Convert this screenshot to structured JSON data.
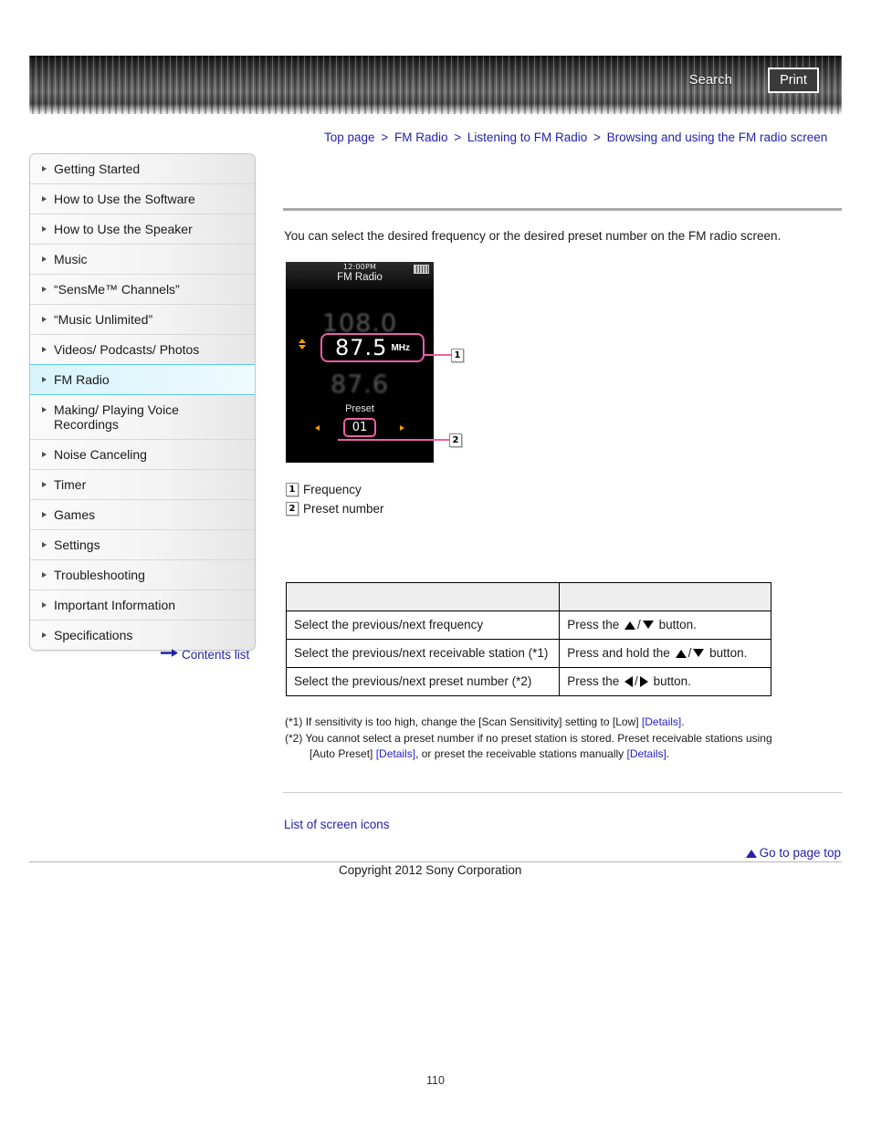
{
  "header": {
    "search_label": "Search",
    "print_label": "Print"
  },
  "breadcrumb": {
    "items": [
      "Top page",
      "FM Radio",
      "Listening to FM Radio",
      "Browsing and using the FM radio screen"
    ],
    "separator": ">"
  },
  "sidebar": {
    "items": [
      {
        "label": "Getting Started",
        "active": false
      },
      {
        "label": "How to Use the Software",
        "active": false
      },
      {
        "label": "How to Use the Speaker",
        "active": false
      },
      {
        "label": "Music",
        "active": false
      },
      {
        "label": "“SensMe™ Channels”",
        "active": false
      },
      {
        "label": "“Music Unlimited”",
        "active": false
      },
      {
        "label": "Videos/ Podcasts/ Photos",
        "active": false
      },
      {
        "label": "FM Radio",
        "active": true
      },
      {
        "label": "Making/ Playing Voice Recordings",
        "active": false
      },
      {
        "label": "Noise Canceling",
        "active": false
      },
      {
        "label": "Timer",
        "active": false
      },
      {
        "label": "Games",
        "active": false
      },
      {
        "label": "Settings",
        "active": false
      },
      {
        "label": "Troubleshooting",
        "active": false
      },
      {
        "label": "Important Information",
        "active": false
      },
      {
        "label": "Specifications",
        "active": false
      }
    ],
    "contents_list_label": "Contents list"
  },
  "main": {
    "intro": "You can select the desired frequency or the desired preset number on the FM radio screen.",
    "device": {
      "time": "12:00PM",
      "title": "FM Radio",
      "frequency_above": "108.0",
      "frequency_value": "87.5",
      "frequency_unit": "MHz",
      "frequency_below": "87.6",
      "preset_label": "Preset",
      "preset_value": "01"
    },
    "callouts": [
      {
        "marker": "1"
      },
      {
        "marker": "2"
      }
    ],
    "legend": [
      {
        "marker": "1",
        "label": "Frequency"
      },
      {
        "marker": "2",
        "label": "Preset number"
      }
    ],
    "table": {
      "header": [
        "",
        ""
      ],
      "rows": [
        {
          "action": "Select the previous/next frequency",
          "operation_prefix": "Press the",
          "icons": [
            "triangle-up",
            "triangle-down"
          ],
          "operation_suffix": "button."
        },
        {
          "action": "Select the previous/next receivable station (*1)",
          "operation_prefix": "Press and hold the",
          "icons": [
            "triangle-up",
            "triangle-down"
          ],
          "operation_suffix": "button."
        },
        {
          "action": "Select the previous/next preset number (*2)",
          "operation_prefix": "Press the",
          "icons": [
            "triangle-left",
            "triangle-right"
          ],
          "operation_suffix": "button."
        }
      ]
    },
    "footnotes": {
      "note1_marker": "(*1)",
      "note1_text_a": "If sensitivity is too high, change the [Scan Sensitivity] setting to [Low] ",
      "note1_link": "[Details]",
      "note1_text_b": ".",
      "note2_marker": "(*2)",
      "note2_text_a": "You cannot select a preset number if no preset station is stored. Preset receivable stations using",
      "note2_text_b": "[Auto Preset] ",
      "note2_link1": "[Details]",
      "note2_text_c": ", or preset the receivable stations manually ",
      "note2_link2": "[Details]",
      "note2_text_d": "."
    }
  },
  "footer": {
    "screen_icons_link": "List of screen icons",
    "go_top_label": "Go to page top",
    "copyright": "Copyright 2012 Sony Corporation",
    "page_number": "110"
  }
}
